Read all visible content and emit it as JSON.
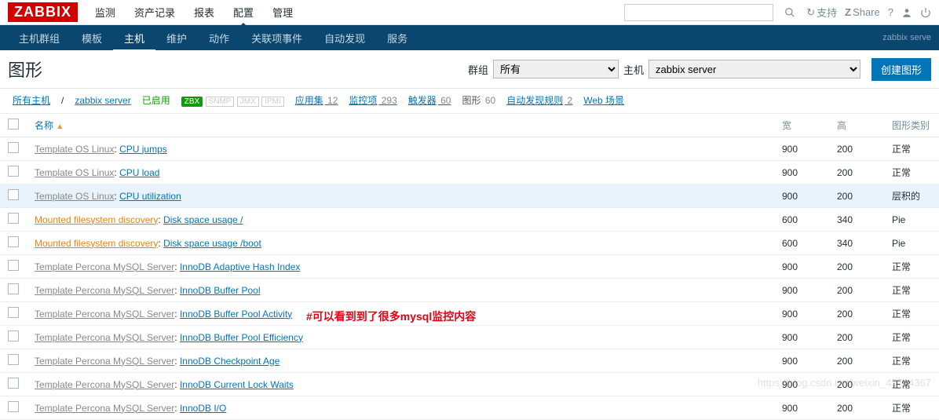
{
  "brand": "ZABBIX",
  "top_menu": [
    "监测",
    "资产记录",
    "报表",
    "配置",
    "管理"
  ],
  "top_menu_active": 3,
  "top_right": {
    "support": "支持",
    "share": "Share",
    "help": "?"
  },
  "secondary_menu": [
    "主机群组",
    "模板",
    "主机",
    "维护",
    "动作",
    "关联项事件",
    "自动发现",
    "服务"
  ],
  "secondary_active": 2,
  "sec_right": "zabbix serve",
  "page_title": "图形",
  "filter": {
    "group_label": "群组",
    "group_value": "所有",
    "host_label": "主机",
    "host_value": "zabbix server",
    "create_btn": "创建图形"
  },
  "breadcrumb": {
    "all_hosts": "所有主机",
    "host": "zabbix server",
    "enabled": "已启用",
    "zbx": "ZBX",
    "snmp": "SNMP",
    "jmx": "JMX",
    "ipmi": "IPMI",
    "tabs": [
      {
        "label": "应用集",
        "count": "12"
      },
      {
        "label": "监控项",
        "count": "293"
      },
      {
        "label": "触发器",
        "count": "60"
      },
      {
        "label": "图形",
        "count": "60"
      },
      {
        "label": "自动发现规则",
        "count": "2"
      },
      {
        "label": "Web 场景",
        "count": ""
      }
    ],
    "active_tab": 3
  },
  "table_headers": {
    "name": "名称",
    "width": "宽",
    "height": "高",
    "type": "图形类别"
  },
  "rows": [
    {
      "tpl": "Template OS Linux",
      "tplcls": "tpl",
      "name": "CPU jumps",
      "w": "900",
      "h": "200",
      "t": "正常"
    },
    {
      "tpl": "Template OS Linux",
      "tplcls": "tpl",
      "name": "CPU load",
      "w": "900",
      "h": "200",
      "t": "正常"
    },
    {
      "tpl": "Template OS Linux",
      "tplcls": "tpl",
      "name": "CPU utilization",
      "w": "900",
      "h": "200",
      "t": "层积的"
    },
    {
      "tpl": "Mounted filesystem discovery",
      "tplcls": "mnt",
      "name": "Disk space usage /",
      "w": "600",
      "h": "340",
      "t": "Pie"
    },
    {
      "tpl": "Mounted filesystem discovery",
      "tplcls": "mnt",
      "name": "Disk space usage /boot",
      "w": "600",
      "h": "340",
      "t": "Pie"
    },
    {
      "tpl": "Template Percona MySQL Server",
      "tplcls": "tpl",
      "name": "InnoDB Adaptive Hash Index",
      "w": "900",
      "h": "200",
      "t": "正常"
    },
    {
      "tpl": "Template Percona MySQL Server",
      "tplcls": "tpl",
      "name": "InnoDB Buffer Pool",
      "w": "900",
      "h": "200",
      "t": "正常"
    },
    {
      "tpl": "Template Percona MySQL Server",
      "tplcls": "tpl",
      "name": "InnoDB Buffer Pool Activity",
      "w": "900",
      "h": "200",
      "t": "正常"
    },
    {
      "tpl": "Template Percona MySQL Server",
      "tplcls": "tpl",
      "name": "InnoDB Buffer Pool Efficiency",
      "w": "900",
      "h": "200",
      "t": "正常"
    },
    {
      "tpl": "Template Percona MySQL Server",
      "tplcls": "tpl",
      "name": "InnoDB Checkpoint Age",
      "w": "900",
      "h": "200",
      "t": "正常"
    },
    {
      "tpl": "Template Percona MySQL Server",
      "tplcls": "tpl",
      "name": "InnoDB Current Lock Waits",
      "w": "900",
      "h": "200",
      "t": "正常"
    },
    {
      "tpl": "Template Percona MySQL Server",
      "tplcls": "tpl",
      "name": "InnoDB I/O",
      "w": "900",
      "h": "200",
      "t": "正常"
    }
  ],
  "annotation": "#可以看到到了很多mysql监控内容",
  "watermark": "https://blog.csdn.net/weixin_45784367"
}
